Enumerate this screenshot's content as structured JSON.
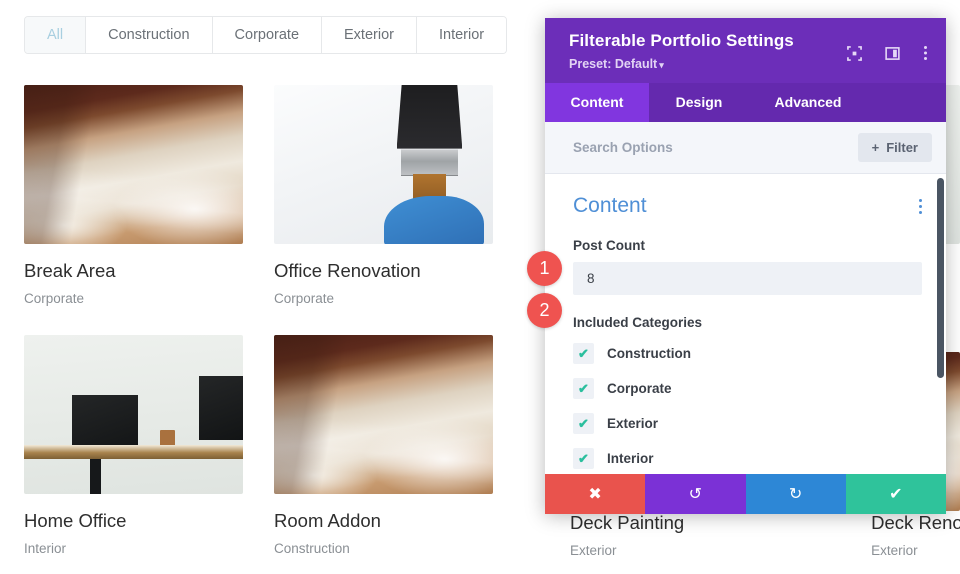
{
  "portfolio": {
    "filters": [
      {
        "label": "All",
        "active": true
      },
      {
        "label": "Construction",
        "active": false
      },
      {
        "label": "Corporate",
        "active": false
      },
      {
        "label": "Exterior",
        "active": false
      },
      {
        "label": "Interior",
        "active": false
      }
    ],
    "items": [
      {
        "title": "Break Area",
        "category": "Corporate",
        "image": "wood-workbench-photo"
      },
      {
        "title": "Office Renovation",
        "category": "Corporate",
        "image": "paintbrush-gloved-hand-photo"
      },
      {
        "title": "Home Office",
        "category": "Interior",
        "image": "desk-laptops-photo"
      },
      {
        "title": "Room Addon",
        "category": "Construction",
        "image": "wood-workbench-photo"
      }
    ],
    "occluded_items": [
      {
        "title": "Deck Painting",
        "category": "Exterior"
      },
      {
        "title": "Deck Renovation",
        "category": "Exterior"
      }
    ]
  },
  "modal": {
    "title": "Filterable Portfolio Settings",
    "preset_label": "Preset: Default",
    "preset_caret": "▾",
    "header_icons": [
      {
        "name": "focus-target-icon"
      },
      {
        "name": "panel-layout-icon"
      },
      {
        "name": "overflow-menu-icon"
      }
    ],
    "tabs": [
      {
        "label": "Content",
        "active": true
      },
      {
        "label": "Design",
        "active": false
      },
      {
        "label": "Advanced",
        "active": false
      }
    ],
    "search": {
      "placeholder": "Search Options",
      "filter_button_label": "Filter",
      "filter_button_icon": "plus-icon"
    },
    "section": {
      "title": "Content",
      "menu_icon": "section-overflow-icon"
    },
    "post_count": {
      "label": "Post Count",
      "value": "8"
    },
    "included_categories": {
      "label": "Included Categories",
      "options": [
        {
          "label": "Construction",
          "checked": true
        },
        {
          "label": "Corporate",
          "checked": true
        },
        {
          "label": "Exterior",
          "checked": true
        },
        {
          "label": "Interior",
          "checked": true
        }
      ],
      "check_glyph": "✔"
    },
    "footer_buttons": [
      {
        "name": "cancel-button",
        "glyph": "✖",
        "color": "#e9534d"
      },
      {
        "name": "undo-button",
        "glyph": "↺",
        "color": "#7b31d6"
      },
      {
        "name": "redo-button",
        "glyph": "↻",
        "color": "#2d87d6"
      },
      {
        "name": "save-button",
        "glyph": "✔",
        "color": "#2fc39b"
      }
    ]
  },
  "annotations": {
    "badges": [
      {
        "number": "1"
      },
      {
        "number": "2"
      }
    ]
  },
  "colors": {
    "modal_header_purple": "#6c2eb9",
    "tab_active_purple": "#8136df",
    "section_blue": "#4f8fd6",
    "check_teal": "#2bbf9e",
    "badge_red": "#ef5350"
  }
}
